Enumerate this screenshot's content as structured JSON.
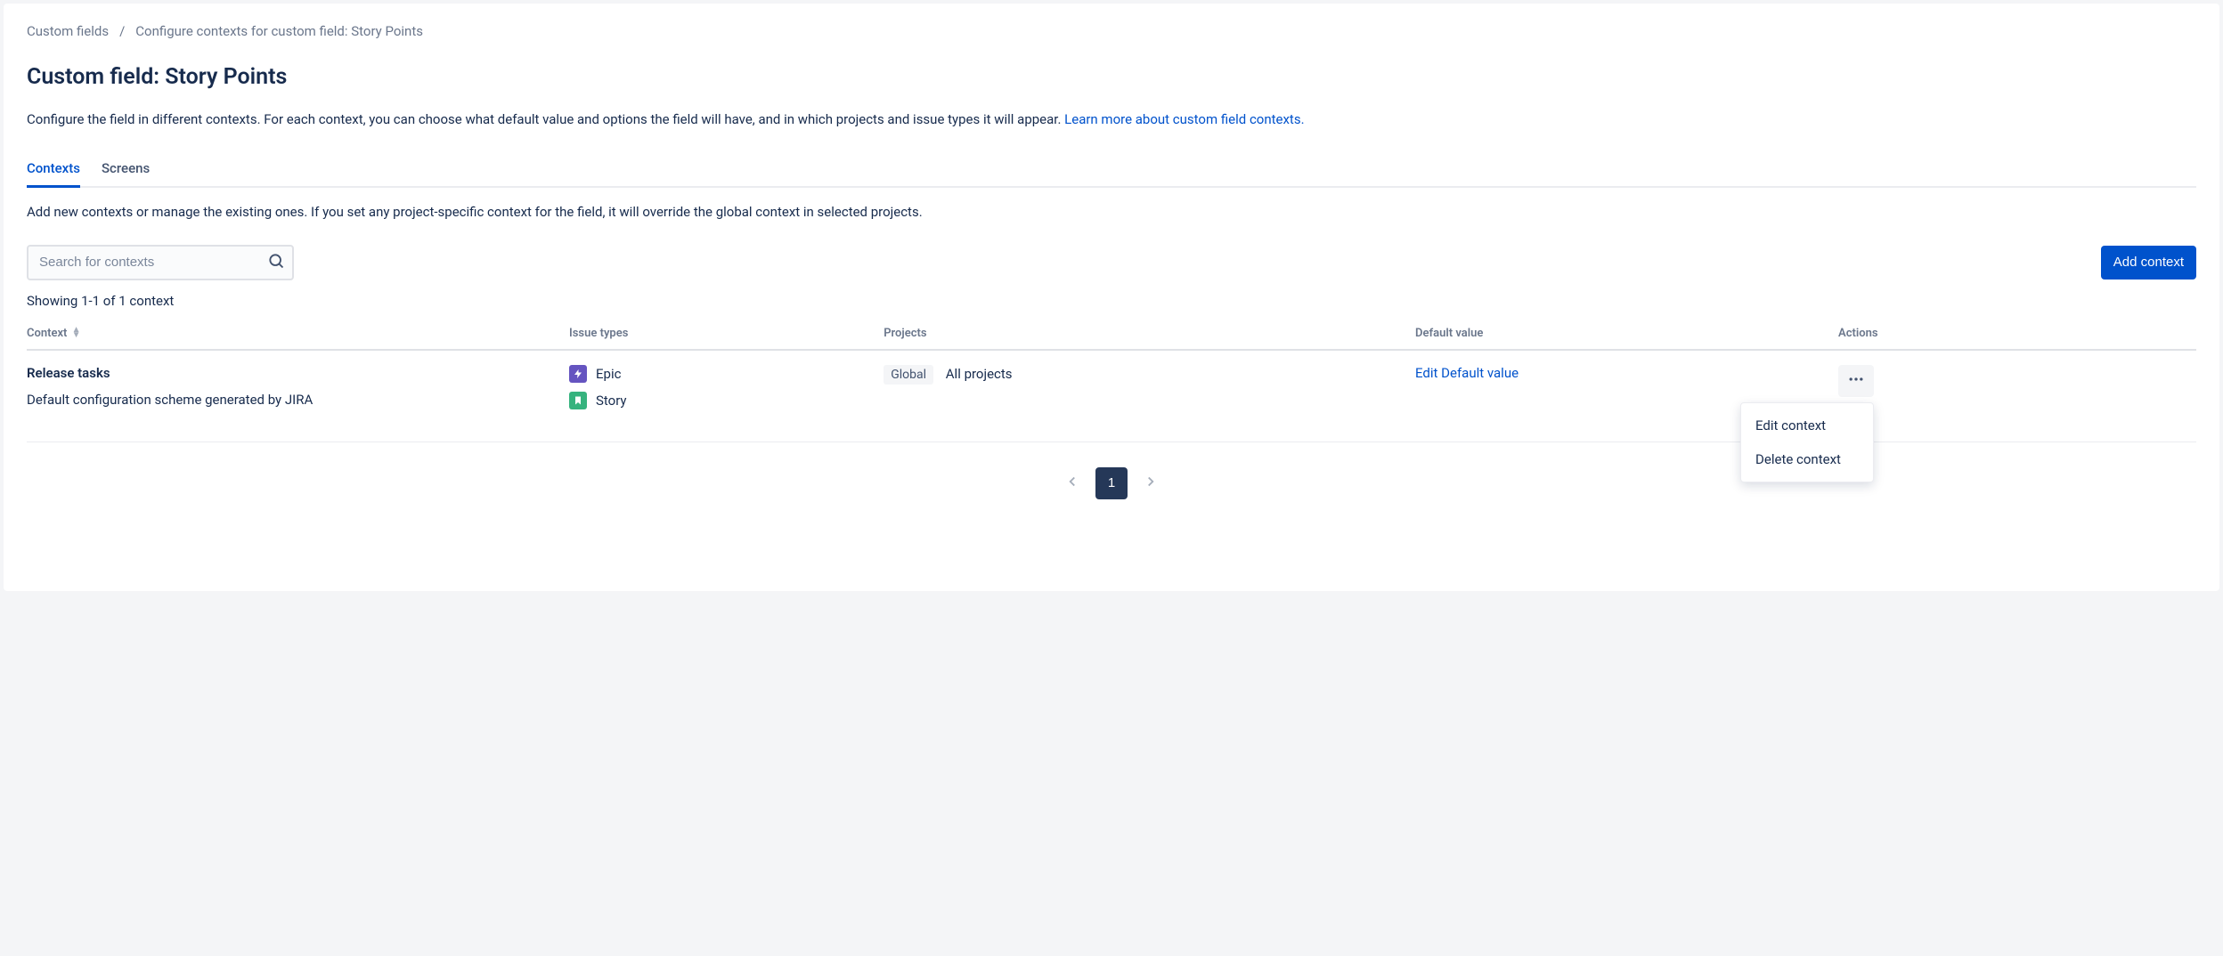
{
  "breadcrumb": {
    "parent": "Custom fields",
    "current": "Configure contexts for custom field: Story Points"
  },
  "header": {
    "title": "Custom field: Story Points"
  },
  "description": {
    "text": "Configure the field in different contexts. For each context, you can choose what default value and options the field will have, and in which projects and issue types it will appear. ",
    "link": "Learn more about custom field contexts."
  },
  "tabs": {
    "items": [
      {
        "label": "Contexts",
        "active": true
      },
      {
        "label": "Screens",
        "active": false
      }
    ]
  },
  "tabDescription": "Add new contexts or manage the existing ones. If you set any project-specific context for the field, it will override the global context in selected projects.",
  "search": {
    "placeholder": "Search for contexts"
  },
  "actions": {
    "addContext": "Add context"
  },
  "resultCount": "Showing 1-1 of 1 context",
  "table": {
    "headers": {
      "context": "Context",
      "issueTypes": "Issue types",
      "projects": "Projects",
      "defaultValue": "Default value",
      "actions": "Actions"
    },
    "rows": [
      {
        "name": "Release tasks",
        "description": "Default configuration scheme generated by JIRA",
        "issueTypes": [
          {
            "icon": "epic",
            "label": "Epic"
          },
          {
            "icon": "story",
            "label": "Story"
          }
        ],
        "projects": {
          "badge": "Global",
          "text": "All projects"
        },
        "defaultValue": {
          "link": "Edit Default value"
        }
      }
    ]
  },
  "rowMenu": {
    "edit": "Edit context",
    "delete": "Delete context"
  },
  "pagination": {
    "current": "1"
  }
}
